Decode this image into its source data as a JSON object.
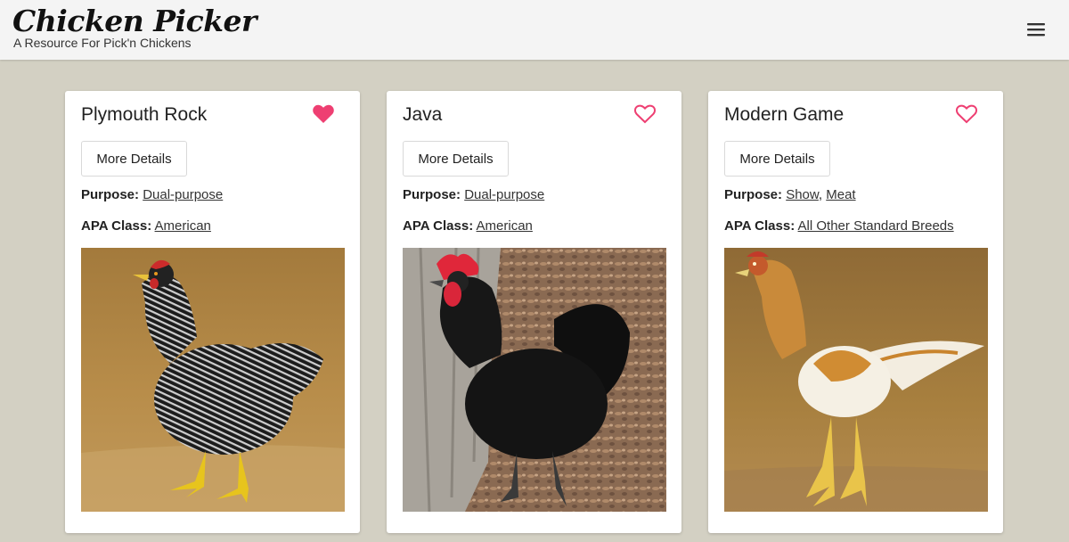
{
  "header": {
    "logo": "Chicken Picker",
    "tagline": "A Resource For Pick'n Chickens",
    "menu_icon": "hamburger-menu-icon"
  },
  "colors": {
    "page_background": "#d3d0c3",
    "header_background": "#f4f4f4",
    "favorite_accent": "#ee3f72"
  },
  "cards": [
    {
      "title": "Plymouth Rock",
      "favorited": true,
      "details_label": "More Details",
      "purpose_label": "Purpose:",
      "purpose_values": [
        "Dual-purpose"
      ],
      "apa_label": "APA Class:",
      "apa_value": "American",
      "photo_alt": "Barred Plymouth Rock hen"
    },
    {
      "title": "Java",
      "favorited": false,
      "details_label": "More Details",
      "purpose_label": "Purpose:",
      "purpose_values": [
        "Dual-purpose"
      ],
      "apa_label": "APA Class:",
      "apa_value": "American",
      "photo_alt": "Black Java rooster"
    },
    {
      "title": "Modern Game",
      "favorited": false,
      "details_label": "More Details",
      "purpose_label": "Purpose:",
      "purpose_values": [
        "Show",
        "Meat"
      ],
      "apa_label": "APA Class:",
      "apa_value": "All Other Standard Breeds",
      "photo_alt": "Modern Game rooster"
    }
  ]
}
